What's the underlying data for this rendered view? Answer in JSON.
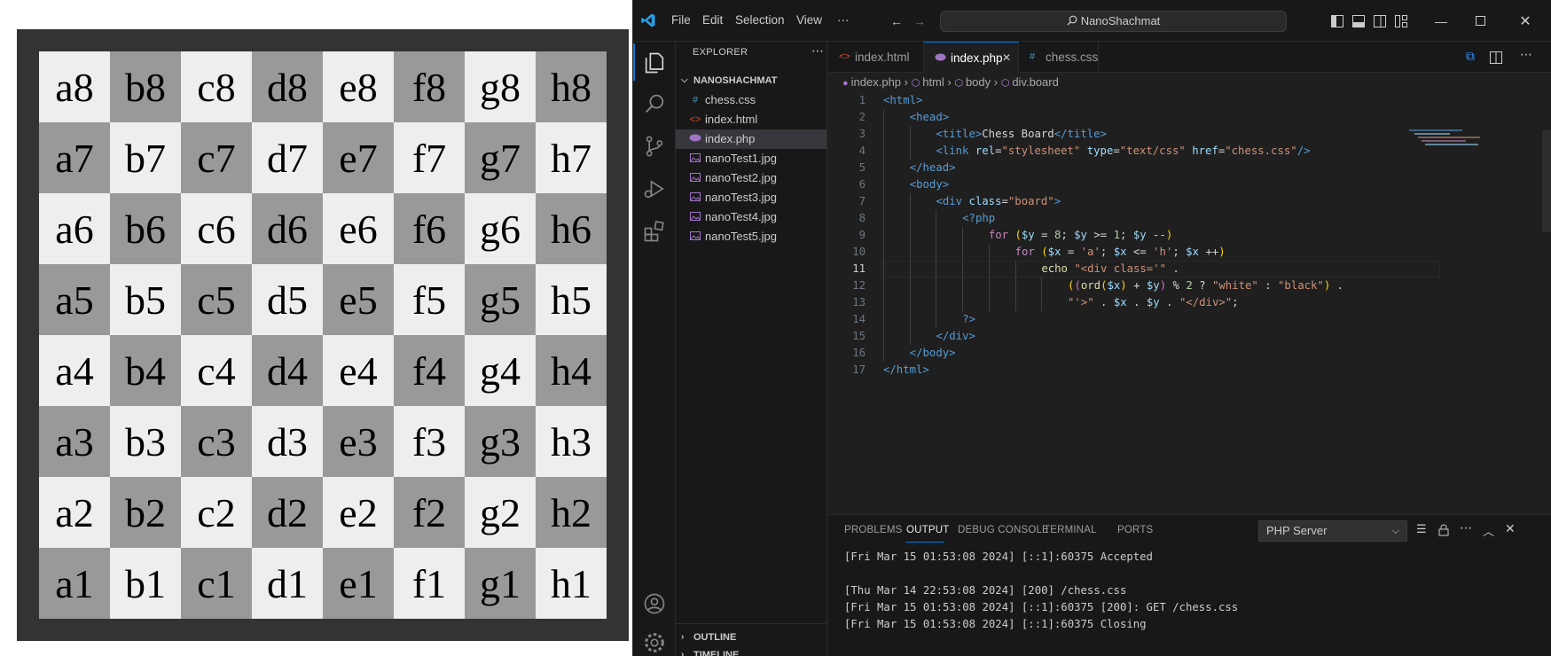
{
  "chessboard": {
    "white_color": "#eeeeee",
    "black_color": "#999999",
    "squares": [
      {
        "label": "a8",
        "color": "white"
      },
      {
        "label": "b8",
        "color": "black"
      },
      {
        "label": "c8",
        "color": "white"
      },
      {
        "label": "d8",
        "color": "black"
      },
      {
        "label": "e8",
        "color": "white"
      },
      {
        "label": "f8",
        "color": "black"
      },
      {
        "label": "g8",
        "color": "white"
      },
      {
        "label": "h8",
        "color": "black"
      },
      {
        "label": "a7",
        "color": "black"
      },
      {
        "label": "b7",
        "color": "white"
      },
      {
        "label": "c7",
        "color": "black"
      },
      {
        "label": "d7",
        "color": "white"
      },
      {
        "label": "e7",
        "color": "black"
      },
      {
        "label": "f7",
        "color": "white"
      },
      {
        "label": "g7",
        "color": "black"
      },
      {
        "label": "h7",
        "color": "white"
      },
      {
        "label": "a6",
        "color": "white"
      },
      {
        "label": "b6",
        "color": "black"
      },
      {
        "label": "c6",
        "color": "white"
      },
      {
        "label": "d6",
        "color": "black"
      },
      {
        "label": "e6",
        "color": "white"
      },
      {
        "label": "f6",
        "color": "black"
      },
      {
        "label": "g6",
        "color": "white"
      },
      {
        "label": "h6",
        "color": "black"
      },
      {
        "label": "a5",
        "color": "black"
      },
      {
        "label": "b5",
        "color": "white"
      },
      {
        "label": "c5",
        "color": "black"
      },
      {
        "label": "d5",
        "color": "white"
      },
      {
        "label": "e5",
        "color": "black"
      },
      {
        "label": "f5",
        "color": "white"
      },
      {
        "label": "g5",
        "color": "black"
      },
      {
        "label": "h5",
        "color": "white"
      },
      {
        "label": "a4",
        "color": "white"
      },
      {
        "label": "b4",
        "color": "black"
      },
      {
        "label": "c4",
        "color": "white"
      },
      {
        "label": "d4",
        "color": "black"
      },
      {
        "label": "e4",
        "color": "white"
      },
      {
        "label": "f4",
        "color": "black"
      },
      {
        "label": "g4",
        "color": "white"
      },
      {
        "label": "h4",
        "color": "black"
      },
      {
        "label": "a3",
        "color": "black"
      },
      {
        "label": "b3",
        "color": "white"
      },
      {
        "label": "c3",
        "color": "black"
      },
      {
        "label": "d3",
        "color": "white"
      },
      {
        "label": "e3",
        "color": "black"
      },
      {
        "label": "f3",
        "color": "white"
      },
      {
        "label": "g3",
        "color": "black"
      },
      {
        "label": "h3",
        "color": "white"
      },
      {
        "label": "a2",
        "color": "white"
      },
      {
        "label": "b2",
        "color": "black"
      },
      {
        "label": "c2",
        "color": "white"
      },
      {
        "label": "d2",
        "color": "black"
      },
      {
        "label": "e2",
        "color": "white"
      },
      {
        "label": "f2",
        "color": "black"
      },
      {
        "label": "g2",
        "color": "white"
      },
      {
        "label": "h2",
        "color": "black"
      },
      {
        "label": "a1",
        "color": "black"
      },
      {
        "label": "b1",
        "color": "white"
      },
      {
        "label": "c1",
        "color": "black"
      },
      {
        "label": "d1",
        "color": "white"
      },
      {
        "label": "e1",
        "color": "black"
      },
      {
        "label": "f1",
        "color": "white"
      },
      {
        "label": "g1",
        "color": "black"
      },
      {
        "label": "h1",
        "color": "white"
      }
    ]
  },
  "vscode": {
    "menu": [
      "File",
      "Edit",
      "Selection",
      "View",
      "···"
    ],
    "search_text": "NanoShachmat",
    "accent": "#0078d4",
    "explorer": {
      "title": "EXPLORER",
      "folder": "NANOSHACHMAT",
      "files": [
        {
          "name": "chess.css",
          "icon": "css-file-icon",
          "glyph": "#",
          "color": "#519aba"
        },
        {
          "name": "index.html",
          "icon": "html-file-icon",
          "glyph": "<>",
          "color": "#e44d26"
        },
        {
          "name": "index.php",
          "icon": "php-file-icon",
          "glyph": "php",
          "color": "#a074c4",
          "active": true
        },
        {
          "name": "nanoTest1.jpg",
          "icon": "image-file-icon",
          "glyph": "img",
          "color": "#a074c4"
        },
        {
          "name": "nanoTest2.jpg",
          "icon": "image-file-icon",
          "glyph": "img",
          "color": "#a074c4"
        },
        {
          "name": "nanoTest3.jpg",
          "icon": "image-file-icon",
          "glyph": "img",
          "color": "#a074c4"
        },
        {
          "name": "nanoTest4.jpg",
          "icon": "image-file-icon",
          "glyph": "img",
          "color": "#a074c4"
        },
        {
          "name": "nanoTest5.jpg",
          "icon": "image-file-icon",
          "glyph": "img",
          "color": "#a074c4"
        }
      ],
      "outline": "OUTLINE",
      "timeline": "TIMELINE"
    },
    "tabs": [
      {
        "label": "index.html",
        "glyph": "<>",
        "color": "#e44d26"
      },
      {
        "label": "index.php",
        "glyph": "php",
        "color": "#a074c4",
        "active": true
      },
      {
        "label": "chess.css",
        "glyph": "#",
        "color": "#519aba"
      }
    ],
    "breadcrumb": [
      "index.php",
      "html",
      "body",
      "div.board"
    ],
    "current_line": 11,
    "code_lines": [
      [
        [
          "t-tag",
          "<html>"
        ]
      ],
      [
        [
          "t-tag",
          "<head>"
        ]
      ],
      [
        [
          "t-tag",
          "<title>"
        ],
        [
          "t-txt",
          "Chess Board"
        ],
        [
          "t-tag",
          "</title>"
        ]
      ],
      [
        [
          "t-tag",
          "<link "
        ],
        [
          "t-attr",
          "rel"
        ],
        [
          "t-op",
          "="
        ],
        [
          "t-str",
          "\"stylesheet\""
        ],
        [
          "t-txt",
          " "
        ],
        [
          "t-attr",
          "type"
        ],
        [
          "t-op",
          "="
        ],
        [
          "t-str",
          "\"text/css\""
        ],
        [
          "t-txt",
          " "
        ],
        [
          "t-attr",
          "href"
        ],
        [
          "t-op",
          "="
        ],
        [
          "t-str",
          "\"chess.css\""
        ],
        [
          "t-tag",
          "/>"
        ]
      ],
      [
        [
          "t-tag",
          "</head>"
        ]
      ],
      [
        [
          "t-tag",
          "<body>"
        ]
      ],
      [
        [
          "t-tag",
          "<div "
        ],
        [
          "t-attr",
          "class"
        ],
        [
          "t-op",
          "="
        ],
        [
          "t-str",
          "\"board\""
        ],
        [
          "t-tag",
          ">"
        ]
      ],
      [
        [
          "t-php",
          "<?php"
        ]
      ],
      [
        [
          "t-kw",
          "for "
        ],
        [
          "t-br",
          "("
        ],
        [
          "t-var",
          "$y"
        ],
        [
          "t-op",
          " = "
        ],
        [
          "t-num",
          "8"
        ],
        [
          "t-op",
          "; "
        ],
        [
          "t-var",
          "$y"
        ],
        [
          "t-op",
          " >= "
        ],
        [
          "t-num",
          "1"
        ],
        [
          "t-op",
          "; "
        ],
        [
          "t-var",
          "$y"
        ],
        [
          "t-op",
          " --"
        ],
        [
          "t-br",
          ")"
        ]
      ],
      [
        [
          "t-kw",
          "for "
        ],
        [
          "t-br",
          "("
        ],
        [
          "t-var",
          "$x"
        ],
        [
          "t-op",
          " = "
        ],
        [
          "t-str",
          "'a'"
        ],
        [
          "t-op",
          "; "
        ],
        [
          "t-var",
          "$x"
        ],
        [
          "t-op",
          " <= "
        ],
        [
          "t-str",
          "'h'"
        ],
        [
          "t-op",
          "; "
        ],
        [
          "t-var",
          "$x"
        ],
        [
          "t-op",
          " ++"
        ],
        [
          "t-br",
          ")"
        ]
      ],
      [
        [
          "t-fn",
          "echo "
        ],
        [
          "t-str",
          "\"<div class='\""
        ],
        [
          "t-op",
          " ."
        ]
      ],
      [
        [
          "t-br",
          "("
        ],
        [
          "t-br2",
          "("
        ],
        [
          "t-fn",
          "ord"
        ],
        [
          "t-br",
          "("
        ],
        [
          "t-var",
          "$x"
        ],
        [
          "t-br",
          ")"
        ],
        [
          "t-op",
          " + "
        ],
        [
          "t-var",
          "$y"
        ],
        [
          "t-br2",
          ")"
        ],
        [
          "t-op",
          " % "
        ],
        [
          "t-num",
          "2"
        ],
        [
          "t-op",
          " ? "
        ],
        [
          "t-str",
          "\"white\""
        ],
        [
          "t-op",
          " : "
        ],
        [
          "t-str",
          "\"black\""
        ],
        [
          "t-br",
          ")"
        ],
        [
          "t-op",
          " ."
        ]
      ],
      [
        [
          "t-str",
          "\"'>\""
        ],
        [
          "t-op",
          " . "
        ],
        [
          "t-var",
          "$x"
        ],
        [
          "t-op",
          " . "
        ],
        [
          "t-var",
          "$y"
        ],
        [
          "t-op",
          " . "
        ],
        [
          "t-str",
          "\"</div>\""
        ],
        [
          "t-op",
          ";"
        ]
      ],
      [
        [
          "t-php",
          "?>"
        ]
      ],
      [
        [
          "t-tag",
          "</div>"
        ]
      ],
      [
        [
          "t-tag",
          "</body>"
        ]
      ],
      [
        [
          "t-tag",
          "</html>"
        ]
      ]
    ],
    "panel": {
      "tabs": [
        "PROBLEMS",
        "OUTPUT",
        "DEBUG CONSOLE",
        "TERMINAL",
        "PORTS"
      ],
      "active_tab": "OUTPUT",
      "channel": "PHP Server",
      "log": [
        "[Fri Mar 15 01:53:08 2024] [::1]:60375 Accepted",
        "",
        "[Thu Mar 14 22:53:08 2024] [200] /chess.css",
        "[Fri Mar 15 01:53:08 2024] [::1]:60375 [200]: GET /chess.css",
        "[Fri Mar 15 01:53:08 2024] [::1]:60375 Closing"
      ]
    }
  }
}
